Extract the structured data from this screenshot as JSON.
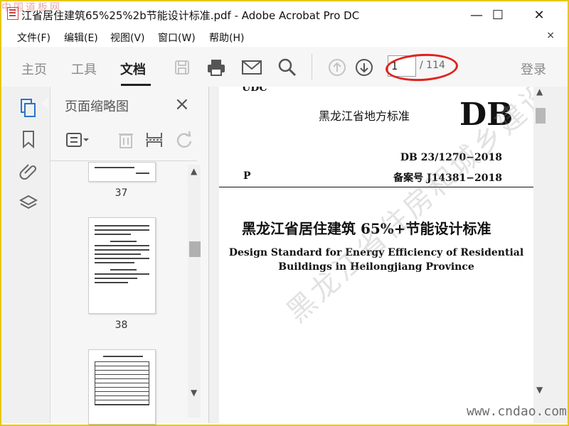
{
  "window": {
    "title": "江省居住建筑65%25%2b节能设计标准.pdf - Adobe Acrobat Pro DC",
    "controls": {
      "minimize": "—",
      "maximize": "☐",
      "close": "✕"
    }
  },
  "menu": {
    "items": [
      "文件(F)",
      "编辑(E)",
      "视图(V)",
      "窗口(W)",
      "帮助(H)"
    ],
    "close_doc": "×"
  },
  "toolbar": {
    "tabs": [
      "主页",
      "工具",
      "文档"
    ],
    "active_tab": "文档",
    "icons": [
      "save-icon",
      "print-icon",
      "email-icon",
      "search-icon",
      "page-up-icon",
      "page-down-icon"
    ],
    "page_current": "1",
    "page_total": "/ 114",
    "login": "登录",
    "annotation_color": "#e0221e"
  },
  "left_rail": {
    "icons": [
      "page-thumbnails-icon",
      "bookmark-icon",
      "attachment-icon",
      "layers-icon"
    ]
  },
  "thumbnail_panel": {
    "title": "页面缩略图",
    "close": "×",
    "tools": [
      "options-icon",
      "delete-icon",
      "extract-icon",
      "rotate-icon"
    ],
    "thumbnails": [
      {
        "label": "37"
      },
      {
        "label": "38"
      }
    ]
  },
  "document": {
    "udc": "UDC",
    "subtitle": "黑龙江省地方标准",
    "db": "DB",
    "std_number": "DB 23/1270−2018",
    "category": "P",
    "record_number": "备案号 J14381−2018",
    "cn_title": "黑龙江省居住建筑 65%+节能设计标准",
    "en_title_line1": "Design Standard for Energy Efficiency of Residential",
    "en_title_line2": "Buildings in Heilongjiang Province",
    "watermark": "黑龙江省住房和城乡建设厅"
  },
  "site_marks": {
    "top_left": "中国道板网",
    "bottom_right": "www.cndao.com"
  }
}
